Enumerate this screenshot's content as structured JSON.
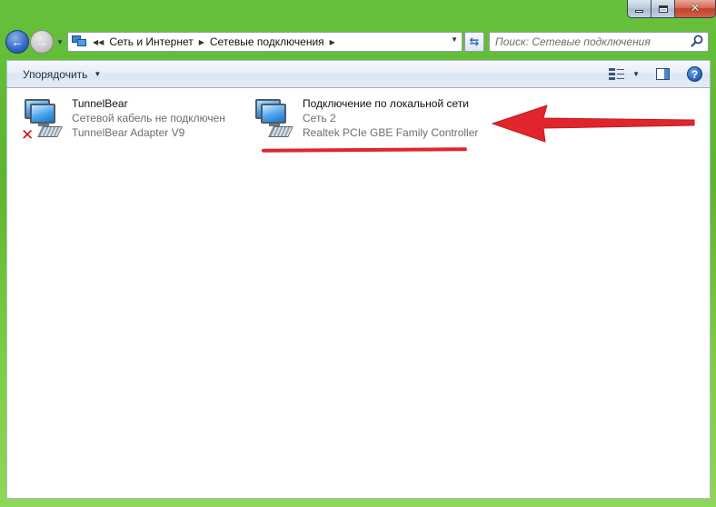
{
  "window": {
    "caption_buttons": {
      "minimize": "minimize",
      "maximize": "maximize",
      "close": "close"
    }
  },
  "nav": {
    "back_icon": "back-arrow-icon",
    "forward_icon": "forward-arrow-icon",
    "breadcrumbs": [
      "Сеть и Интернет",
      "Сетевые подключения"
    ],
    "search_placeholder": "Поиск: Сетевые подключения"
  },
  "toolbar": {
    "organize_label": "Упорядочить"
  },
  "connections": [
    {
      "name": "TunnelBear",
      "status": "Сетевой кабель не подключен",
      "adapter": "TunnelBear Adapter V9",
      "disconnected": true
    },
    {
      "name": "Подключение по локальной сети",
      "status": "Сеть  2",
      "adapter": "Realtek PCIe GBE Family Controller",
      "disconnected": false
    }
  ],
  "annotation": {
    "color": "#e1252d"
  }
}
